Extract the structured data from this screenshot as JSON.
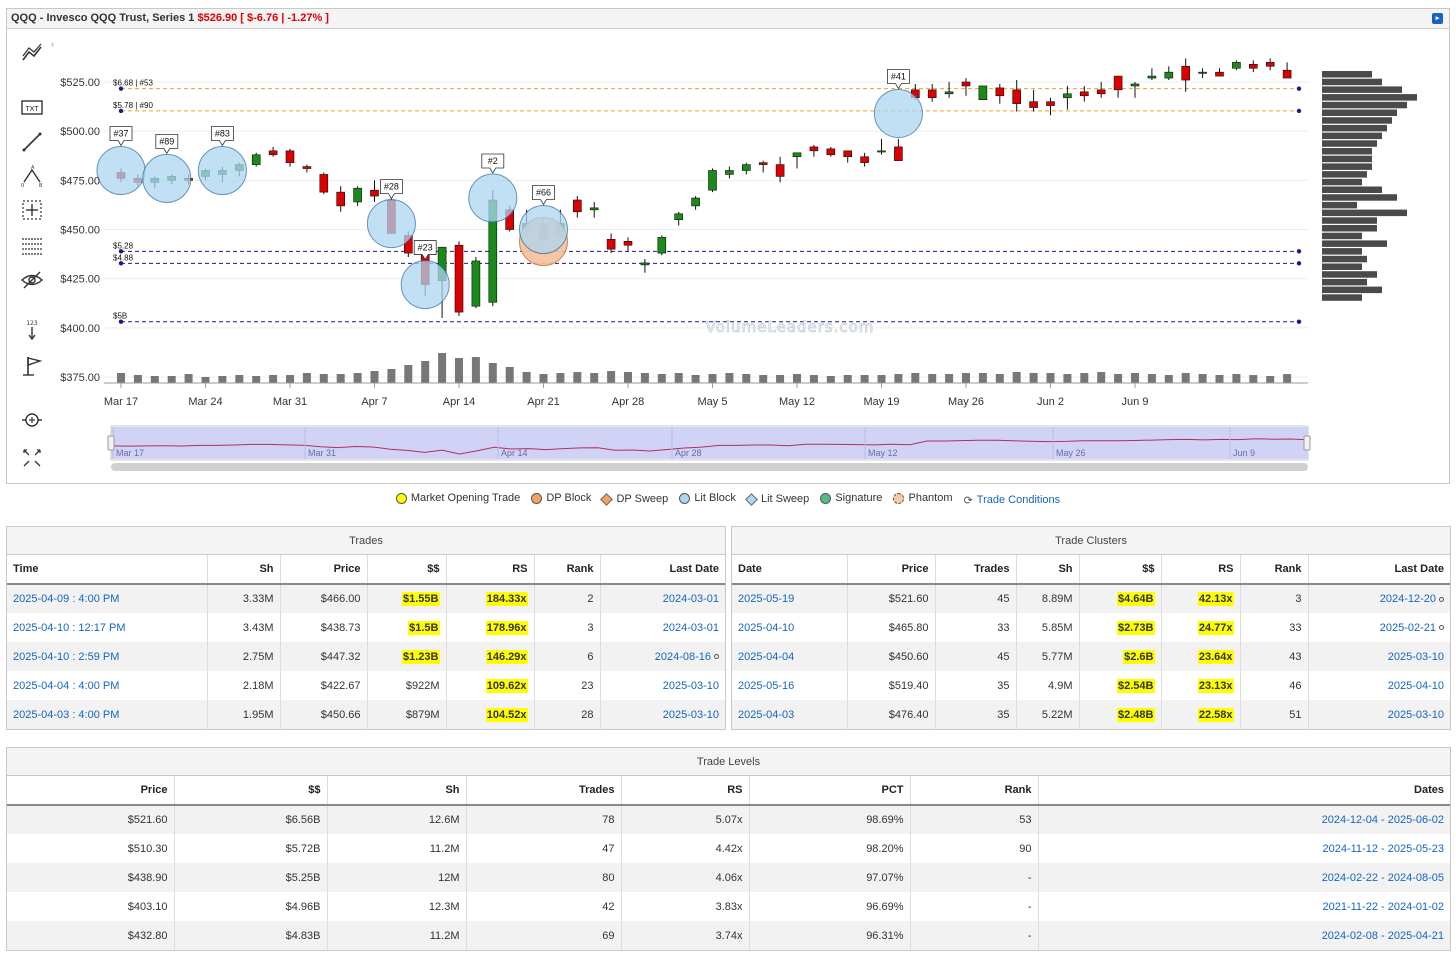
{
  "header": {
    "title": "QQQ - Invesco QQQ Trust, Series 1",
    "price": "$526.90",
    "change": "[ $-6.76 | -1.27% ]"
  },
  "watermark": "VolumeLeaders.com",
  "chart_data": {
    "type": "candlestick",
    "y_ticks": [
      "$525.00",
      "$500.00",
      "$475.00",
      "$450.00",
      "$425.00",
      "$400.00",
      "$375.00"
    ],
    "x_ticks": [
      "Mar 17",
      "Mar 24",
      "Mar 31",
      "Apr 7",
      "Apr 14",
      "Apr 21",
      "Apr 28",
      "May 5",
      "May 12",
      "May 19",
      "May 26",
      "Jun 2",
      "Jun 9"
    ],
    "navigator_labels": [
      "Mar 17",
      "Mar 31",
      "Apr 14",
      "Apr 28",
      "May 12",
      "May 26",
      "Jun 9"
    ],
    "levels": [
      {
        "label": "$6.68 | #53",
        "price": 521.6,
        "style": "orange"
      },
      {
        "label": "$5.78 | #90",
        "price": 510.3,
        "style": "orange"
      },
      {
        "label": "$5.28",
        "price": 438.9,
        "style": "navy"
      },
      {
        "label": "$4.88",
        "price": 432.8,
        "style": "navy"
      },
      {
        "label": "$5B",
        "price": 403.1,
        "style": "navy"
      }
    ],
    "trade_bubbles": [
      {
        "label": "#37",
        "date_index": 0,
        "price": 480
      },
      {
        "label": "#89",
        "date_index": 2,
        "price": 476
      },
      {
        "label": "#83",
        "date_index": 6,
        "price": 480
      },
      {
        "label": "#28",
        "date_index": 16,
        "price": 453
      },
      {
        "label": "#23",
        "date_index": 18,
        "price": 422
      },
      {
        "label": "#2",
        "date_index": 22,
        "price": 466
      },
      {
        "label": "#66",
        "date_index": 25,
        "price": 450
      },
      {
        "label": "#41",
        "date_index": 46,
        "price": 509
      }
    ],
    "candles": [
      [
        479,
        481,
        474,
        476
      ],
      [
        476,
        478,
        472,
        474
      ],
      [
        474,
        477,
        471,
        476
      ],
      [
        475,
        478,
        473,
        477
      ],
      [
        476,
        478,
        473,
        475
      ],
      [
        477,
        481,
        475,
        480
      ],
      [
        478,
        482,
        474,
        480
      ],
      [
        480,
        484,
        477,
        483
      ],
      [
        483,
        489,
        482,
        488
      ],
      [
        490,
        492,
        487,
        488
      ],
      [
        490,
        491,
        482,
        484
      ],
      [
        482,
        483,
        479,
        481
      ],
      [
        478,
        479,
        468,
        469
      ],
      [
        469,
        472,
        459,
        462
      ],
      [
        464,
        472,
        462,
        471
      ],
      [
        470,
        475,
        464,
        467
      ],
      [
        465,
        468,
        448,
        448
      ],
      [
        447,
        449,
        436,
        438
      ],
      [
        438,
        441,
        416,
        422
      ],
      [
        424,
        441,
        405,
        441
      ],
      [
        442,
        444,
        406,
        408
      ],
      [
        411,
        436,
        410,
        434
      ],
      [
        413,
        470,
        411,
        465
      ],
      [
        460,
        462,
        449,
        450
      ],
      [
        450,
        460,
        447,
        453
      ],
      [
        452,
        456,
        443,
        445
      ],
      [
        446,
        460,
        447,
        453
      ],
      [
        465,
        467,
        456,
        459
      ],
      [
        460,
        464,
        456,
        461
      ],
      [
        445,
        448,
        438,
        440
      ],
      [
        444,
        446,
        439,
        442
      ],
      [
        432,
        435,
        428,
        433
      ],
      [
        438,
        447,
        437,
        446
      ],
      [
        455,
        459,
        452,
        458
      ],
      [
        462,
        467,
        460,
        466
      ],
      [
        470,
        481,
        469,
        480
      ],
      [
        478,
        482,
        476,
        480
      ],
      [
        480,
        484,
        478,
        483
      ],
      [
        484,
        485,
        479,
        483
      ],
      [
        483,
        487,
        474,
        477
      ],
      [
        487,
        489,
        481,
        489
      ],
      [
        492,
        493,
        487,
        490
      ],
      [
        491,
        492,
        487,
        488
      ],
      [
        490,
        490,
        484,
        487
      ],
      [
        487,
        489,
        482,
        484
      ],
      [
        490,
        496,
        488,
        490
      ],
      [
        492,
        496,
        486,
        485
      ],
      [
        521,
        524,
        516,
        517
      ],
      [
        521,
        524,
        515,
        517
      ],
      [
        519,
        525,
        517,
        520
      ],
      [
        525,
        527,
        518,
        523
      ],
      [
        516,
        523,
        517,
        523
      ],
      [
        522,
        524,
        514,
        518
      ],
      [
        521,
        526,
        510,
        514
      ],
      [
        515,
        521,
        510,
        512
      ],
      [
        515,
        517,
        508,
        513
      ],
      [
        517,
        523,
        511,
        519
      ],
      [
        520,
        523,
        515,
        518
      ],
      [
        521,
        525,
        517,
        519
      ],
      [
        528,
        528,
        517,
        521
      ],
      [
        523,
        525,
        517,
        524
      ],
      [
        527,
        532,
        526,
        528
      ],
      [
        527,
        533,
        526,
        530
      ],
      [
        533,
        537,
        520,
        526
      ],
      [
        530,
        532,
        527,
        530
      ],
      [
        530,
        532,
        528,
        528
      ],
      [
        532,
        536,
        531,
        535
      ],
      [
        534,
        536,
        530,
        532
      ],
      [
        535,
        537,
        531,
        533
      ],
      [
        531,
        535,
        527,
        527
      ]
    ],
    "volumes": [
      10,
      8,
      7,
      7,
      9,
      6,
      7,
      8,
      7,
      8,
      8,
      10,
      9,
      9,
      10,
      12,
      14,
      18,
      22,
      30,
      25,
      26,
      20,
      16,
      11,
      9,
      10,
      11,
      10,
      12,
      11,
      10,
      9,
      10,
      8,
      9,
      10,
      9,
      8,
      8,
      9,
      8,
      7,
      8,
      8,
      8,
      9,
      10,
      9,
      9,
      10,
      10,
      9,
      11,
      10,
      10,
      9,
      10,
      11,
      9,
      10,
      9,
      8,
      10,
      9,
      8,
      9,
      8,
      7,
      9
    ],
    "volume_profile": [
      10,
      12,
      16,
      19,
      17,
      15,
      14,
      13,
      12,
      11,
      10,
      10,
      10,
      9,
      8,
      12,
      15,
      7,
      17,
      11,
      11,
      8,
      13,
      8,
      9,
      8,
      11,
      9,
      12,
      8
    ],
    "price_range": [
      370,
      540
    ]
  },
  "legend": {
    "items": [
      {
        "label": "Market Opening Trade",
        "color": "#ffff00",
        "shape": "dot"
      },
      {
        "label": "DP Block",
        "color": "#f4a460",
        "shape": "dot"
      },
      {
        "label": "DP Sweep",
        "color": "#f4a460",
        "shape": "diamond"
      },
      {
        "label": "Lit Block",
        "color": "#aed6f1",
        "shape": "dot"
      },
      {
        "label": "Lit Sweep",
        "color": "#aed6f1",
        "shape": "diamond"
      },
      {
        "label": "Signature",
        "color": "#52be80",
        "shape": "dot"
      },
      {
        "label": "Phantom",
        "color": "#f5cba7",
        "shape": "phantom"
      }
    ],
    "trade_conditions": "Trade Conditions"
  },
  "trades": {
    "title": "Trades",
    "headers": [
      "Time",
      "Sh",
      "Price",
      "$$",
      "RS",
      "Rank",
      "Last Date"
    ],
    "rows": [
      [
        "2025-04-09 : 4:00 PM",
        "3.33M",
        "$466.00",
        "$1.55B",
        "184.33x",
        "2",
        "2024-03-01",
        false,
        true
      ],
      [
        "2025-04-10 : 12:17 PM",
        "3.43M",
        "$438.73",
        "$1.5B",
        "178.96x",
        "3",
        "2024-03-01",
        false,
        true
      ],
      [
        "2025-04-10 : 2:59 PM",
        "2.75M",
        "$447.32",
        "$1.23B",
        "146.29x",
        "6",
        "2024-08-16",
        true,
        true
      ],
      [
        "2025-04-04 : 4:00 PM",
        "2.18M",
        "$422.67",
        "$922M",
        "109.62x",
        "23",
        "2025-03-10",
        false,
        false
      ],
      [
        "2025-04-03 : 4:00 PM",
        "1.95M",
        "$450.66",
        "$879M",
        "104.52x",
        "28",
        "2025-03-10",
        false,
        false
      ]
    ]
  },
  "clusters": {
    "title": "Trade Clusters",
    "headers": [
      "Date",
      "Price",
      "Trades",
      "Sh",
      "$$",
      "RS",
      "Rank",
      "Last Date"
    ],
    "rows": [
      [
        "2025-05-19",
        "$521.60",
        "45",
        "8.89M",
        "$4.64B",
        "42.13x",
        "3",
        "2024-12-20",
        true
      ],
      [
        "2025-04-10",
        "$465.80",
        "33",
        "5.85M",
        "$2.73B",
        "24.77x",
        "33",
        "2025-02-21",
        true
      ],
      [
        "2025-04-04",
        "$450.60",
        "45",
        "5.77M",
        "$2.6B",
        "23.64x",
        "43",
        "2025-03-10",
        false
      ],
      [
        "2025-05-16",
        "$519.40",
        "35",
        "4.9M",
        "$2.54B",
        "23.13x",
        "46",
        "2025-04-10",
        false
      ],
      [
        "2025-04-03",
        "$476.40",
        "35",
        "5.22M",
        "$2.48B",
        "22.58x",
        "51",
        "2025-03-10",
        false
      ]
    ]
  },
  "levels_table": {
    "title": "Trade Levels",
    "headers": [
      "Price",
      "$$",
      "Sh",
      "Trades",
      "RS",
      "PCT",
      "Rank",
      "Dates"
    ],
    "rows": [
      [
        "$521.60",
        "$6.56B",
        "12.6M",
        "78",
        "5.07x",
        "98.69%",
        "53",
        "2024-12-04 - 2025-06-02"
      ],
      [
        "$510.30",
        "$5.72B",
        "11.2M",
        "47",
        "4.42x",
        "98.20%",
        "90",
        "2024-11-12 - 2025-05-23"
      ],
      [
        "$438.90",
        "$5.25B",
        "12M",
        "80",
        "4.06x",
        "97.07%",
        "-",
        "2024-02-22 - 2024-08-05"
      ],
      [
        "$403.10",
        "$4.96B",
        "12.3M",
        "42",
        "3.83x",
        "96.69%",
        "-",
        "2021-11-22 - 2024-01-02"
      ],
      [
        "$432.80",
        "$4.83B",
        "11.2M",
        "69",
        "3.74x",
        "96.31%",
        "-",
        "2024-02-08 - 2025-04-21"
      ]
    ]
  },
  "colors": {
    "up": "#1a8a1a",
    "down": "#dd0000",
    "orange_line": "#f0a020",
    "navy_line": "#1a1a8c",
    "link": "#1565c0",
    "highlight": "#ffff00"
  },
  "icons": [
    "trend-line-tool-icon",
    "text-tool-icon",
    "line-tool-icon",
    "pitchfork-tool-icon",
    "crosshair-tool-icon",
    "fibonacci-tool-icon",
    "hide-drawings-icon",
    "price-label-tool-icon",
    "flag-tool-icon",
    "zoom-icon",
    "fullscreen-icon"
  ]
}
